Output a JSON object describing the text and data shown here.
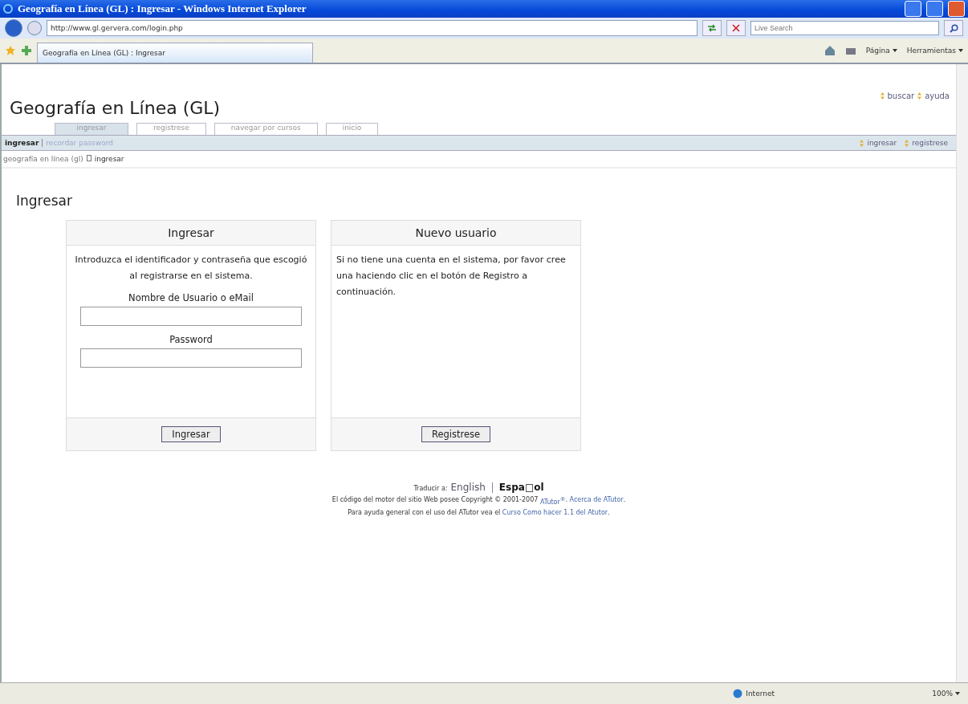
{
  "window": {
    "title": "Geografía en Línea (GL) : Ingresar - Windows Internet Explorer"
  },
  "address_bar": {
    "value": "http://www.gl.gervera.com/login.php"
  },
  "search": {
    "placeholder": "Live Search"
  },
  "browser_tabs": [
    {
      "label": "Geografía en Línea (GL) : Ingresar",
      "selected": true
    }
  ],
  "command_bar": [
    "Página",
    "Herramientas"
  ],
  "site": {
    "title": "Geografía en Línea (GL)",
    "top_links": [
      "buscar",
      "ayuda"
    ]
  },
  "tabs": [
    {
      "label": "ingresar",
      "selected": true
    },
    {
      "label": "registrese",
      "selected": false
    },
    {
      "label": "navegar por cursos",
      "selected": false
    },
    {
      "label": "inicio",
      "selected": false
    }
  ],
  "subnav": [
    {
      "label": "ingresar",
      "selected": true
    },
    {
      "label": "recordar password",
      "selected": false
    }
  ],
  "subnav_right": [
    "ingresar",
    "registrese"
  ],
  "breadcrumb": [
    "geografía en línea (gl)",
    "ingresar"
  ],
  "heading": "Ingresar",
  "login_box": {
    "title": "Ingresar",
    "text": "Introduzca el identificador y contraseña que escogió al registrarse en el sistema.",
    "fields": [
      {
        "label": "Nombre de Usuario o eMail"
      },
      {
        "label": "Password"
      }
    ],
    "button": "Ingresar"
  },
  "register_box": {
    "title": "Nuevo usuario",
    "text": "Si no tiene una cuenta en el sistema, por favor cree una haciendo clic en el botón de Registro a continuación.",
    "button": "Registrese"
  },
  "footer": {
    "translate_label": "Traducir a:",
    "languages": [
      {
        "label": "English",
        "selected": false
      },
      {
        "label": "Espa□ol",
        "selected": true
      }
    ],
    "lines": [
      [
        {
          "text": "El código del motor del sitio Web posee Copyright © 2001-2007 ",
          "link": false
        },
        {
          "text": "ATutor$^{®}$",
          "link": true
        },
        {
          "text": ". ",
          "link": false
        },
        {
          "text": "Acerca de ATutor",
          "link": true
        },
        {
          "text": ".",
          "link": false
        }
      ],
      [
        {
          "text": "Para ayuda general con el uso del ATutor vea el ",
          "link": false
        },
        {
          "text": "Curso Como hacer 1.1 del Atutor",
          "link": true
        },
        {
          "text": ".",
          "link": false
        }
      ]
    ]
  },
  "status_bar": {
    "zone": "Internet",
    "zoom": "100%"
  }
}
